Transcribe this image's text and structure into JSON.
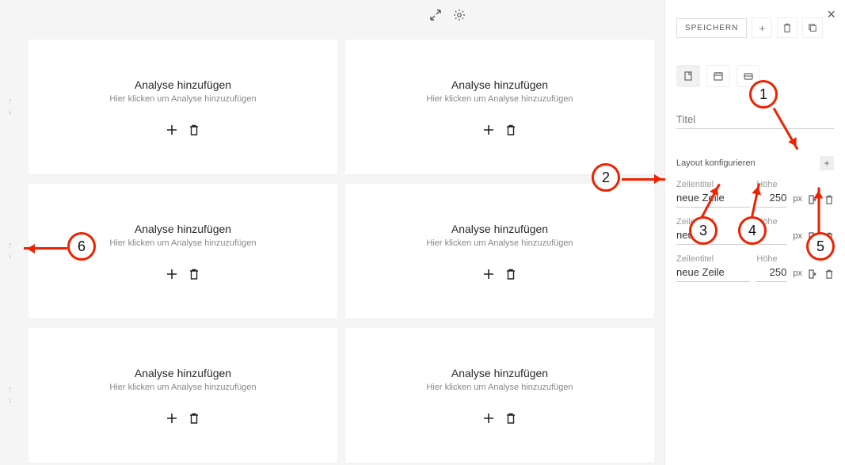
{
  "canvas": {
    "card_title": "Analyse hinzufügen",
    "card_sub": "Hier klicken um Analyse hinzuzufügen"
  },
  "side": {
    "save_label": "SPEICHERN",
    "titel_placeholder": "Titel",
    "layout_label": "Layout konfigurieren",
    "row_title_label": "Zeilentitel",
    "row_title_value": "neue Zeile",
    "height_label": "Höhe",
    "height_value": "250",
    "height_unit": "px",
    "rows": [
      {
        "title": "neue Zeile",
        "height": "250",
        "unit": "px"
      },
      {
        "title": "neue",
        "height": "",
        "unit": "px"
      },
      {
        "title": "neue Zeile",
        "height": "250",
        "unit": "px"
      }
    ]
  },
  "annotations": {
    "1": "1",
    "2": "2",
    "3": "3",
    "4": "4",
    "5": "5",
    "6": "6"
  }
}
